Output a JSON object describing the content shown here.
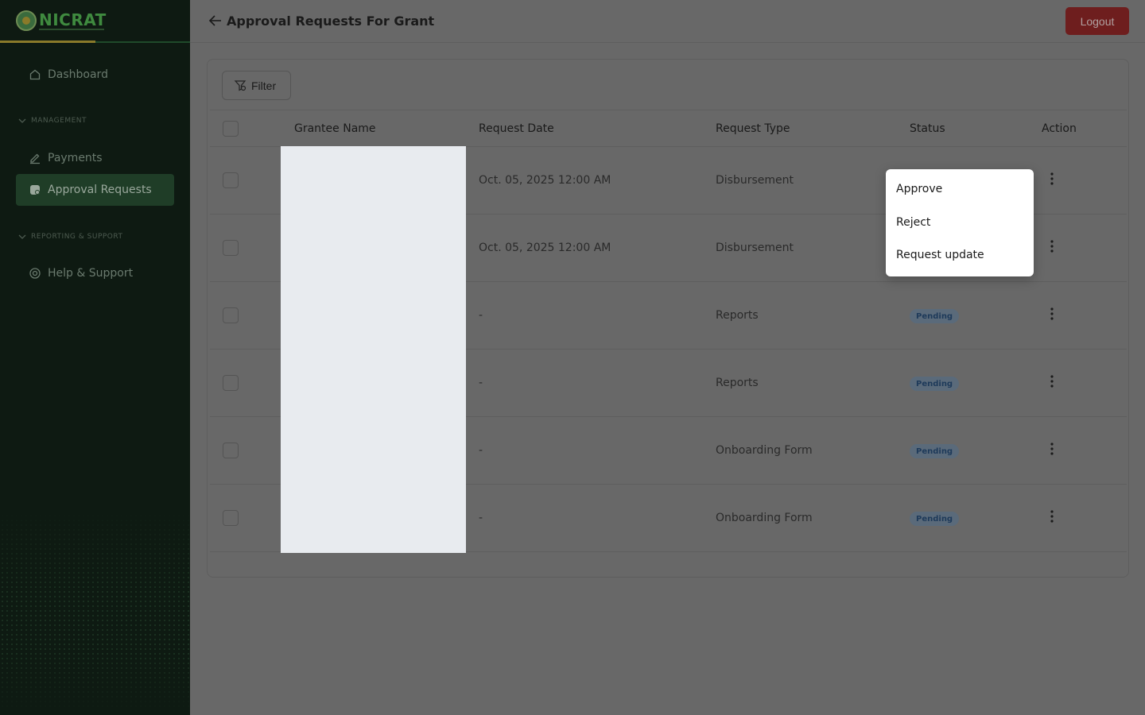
{
  "brand": {
    "logo_text": "NICRAT"
  },
  "sidebar": {
    "items": [
      {
        "label": "Dashboard",
        "icon": "home-icon"
      },
      {
        "label": "Payments",
        "icon": "edit-icon"
      },
      {
        "label": "Approval Requests",
        "icon": "approval-icon",
        "active": true
      },
      {
        "label": "Help & Support",
        "icon": "lifebuoy-icon"
      }
    ],
    "sections": [
      "MANAGEMENT",
      "REPORTING & SUPPORT"
    ]
  },
  "header": {
    "title": "Approval Requests For Grant",
    "logout_label": "Logout"
  },
  "toolbar": {
    "filter_label": "Filter"
  },
  "table": {
    "columns": [
      "Grantee Name",
      "Request Date",
      "Request Type",
      "Status",
      "Action"
    ],
    "rows": [
      {
        "date": "Oct. 05, 2025 12:00 AM",
        "type": "Disbursement",
        "status": ""
      },
      {
        "date": "Oct. 05, 2025 12:00 AM",
        "type": "Disbursement",
        "status": ""
      },
      {
        "date": "-",
        "type": "Reports",
        "status": "Pending"
      },
      {
        "date": "-",
        "type": "Reports",
        "status": "Pending"
      },
      {
        "date": "-",
        "type": "Onboarding Form",
        "status": "Pending"
      },
      {
        "date": "-",
        "type": "Onboarding Form",
        "status": "Pending"
      }
    ]
  },
  "action_menu": {
    "items": [
      "Approve",
      "Reject",
      "Request update"
    ]
  },
  "colors": {
    "brand_green": "#3f8a3f",
    "logout_red": "#8b1a1a",
    "pending_badge": "#1e3a5a"
  }
}
